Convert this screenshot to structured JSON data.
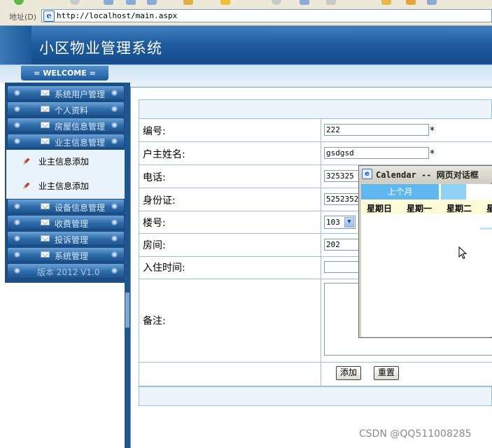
{
  "browser": {
    "address_label": "地址(D)",
    "url": "http://localhost/main.aspx"
  },
  "banner": {
    "title": "小区物业管理系统",
    "welcome": "= WELCOME ="
  },
  "sidebar": {
    "items": [
      {
        "label": "系统用户管理"
      },
      {
        "label": "个人资料"
      },
      {
        "label": "房屋信息管理"
      },
      {
        "label": "业主信息管理"
      },
      {
        "label": "设备信息管理"
      },
      {
        "label": "收费管理"
      },
      {
        "label": "投诉管理"
      },
      {
        "label": "系统管理"
      }
    ],
    "subitems": [
      {
        "label": "业主信息添加"
      },
      {
        "label": "业主信息添加"
      }
    ],
    "version": "版本 2012 V1.0"
  },
  "form": {
    "fields": {
      "number": {
        "label": "编号:",
        "value": "222",
        "required": "*"
      },
      "owner_name": {
        "label": "户主姓名:",
        "value": "gsdgsd",
        "required": "*"
      },
      "phone": {
        "label": "电话:",
        "value": "325325"
      },
      "id_card": {
        "label": "身份证:",
        "value": "5252352"
      },
      "building": {
        "label": "楼号:",
        "value": "103"
      },
      "room": {
        "label": "房间:",
        "value": "202"
      },
      "move_in": {
        "label": "入住时间:",
        "value": ""
      },
      "remark": {
        "label": "备注:",
        "value": ""
      }
    },
    "buttons": {
      "add": "添加",
      "reset": "重置"
    }
  },
  "calendar": {
    "title": "Calendar -- 网页对话框",
    "prev_month": "上个月",
    "weekdays": [
      "星期日",
      "星期一",
      "星期二",
      "星"
    ]
  },
  "watermark": "CSDN @QQ511008285"
}
